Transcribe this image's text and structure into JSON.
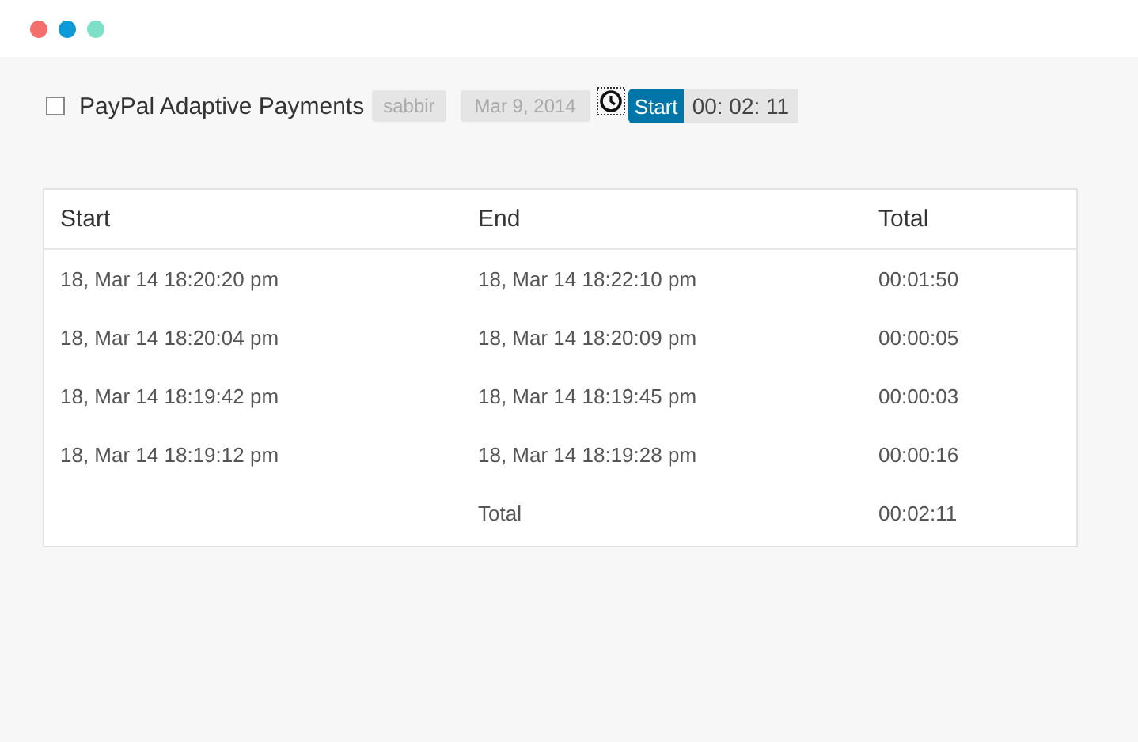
{
  "task": {
    "checked": false,
    "title": "PayPal Adaptive Payments",
    "user": "sabbir",
    "date": "Mar 9, 2014",
    "start_button": "Start",
    "elapsed": "00: 02: 11"
  },
  "table": {
    "columns": [
      "Start",
      "End",
      "Total"
    ],
    "rows": [
      [
        "18, Mar 14 18:20:20 pm",
        "18, Mar 14 18:22:10 pm",
        "00:01:50"
      ],
      [
        "18, Mar 14 18:20:04 pm",
        "18, Mar 14 18:20:09 pm",
        "00:00:05"
      ],
      [
        "18, Mar 14 18:19:42 pm",
        "18, Mar 14 18:19:45 pm",
        "00:00:03"
      ],
      [
        "18, Mar 14 18:19:12 pm",
        "18, Mar 14 18:19:28 pm",
        "00:00:16"
      ]
    ],
    "footer": {
      "label": "Total",
      "value": "00:02:11"
    }
  }
}
